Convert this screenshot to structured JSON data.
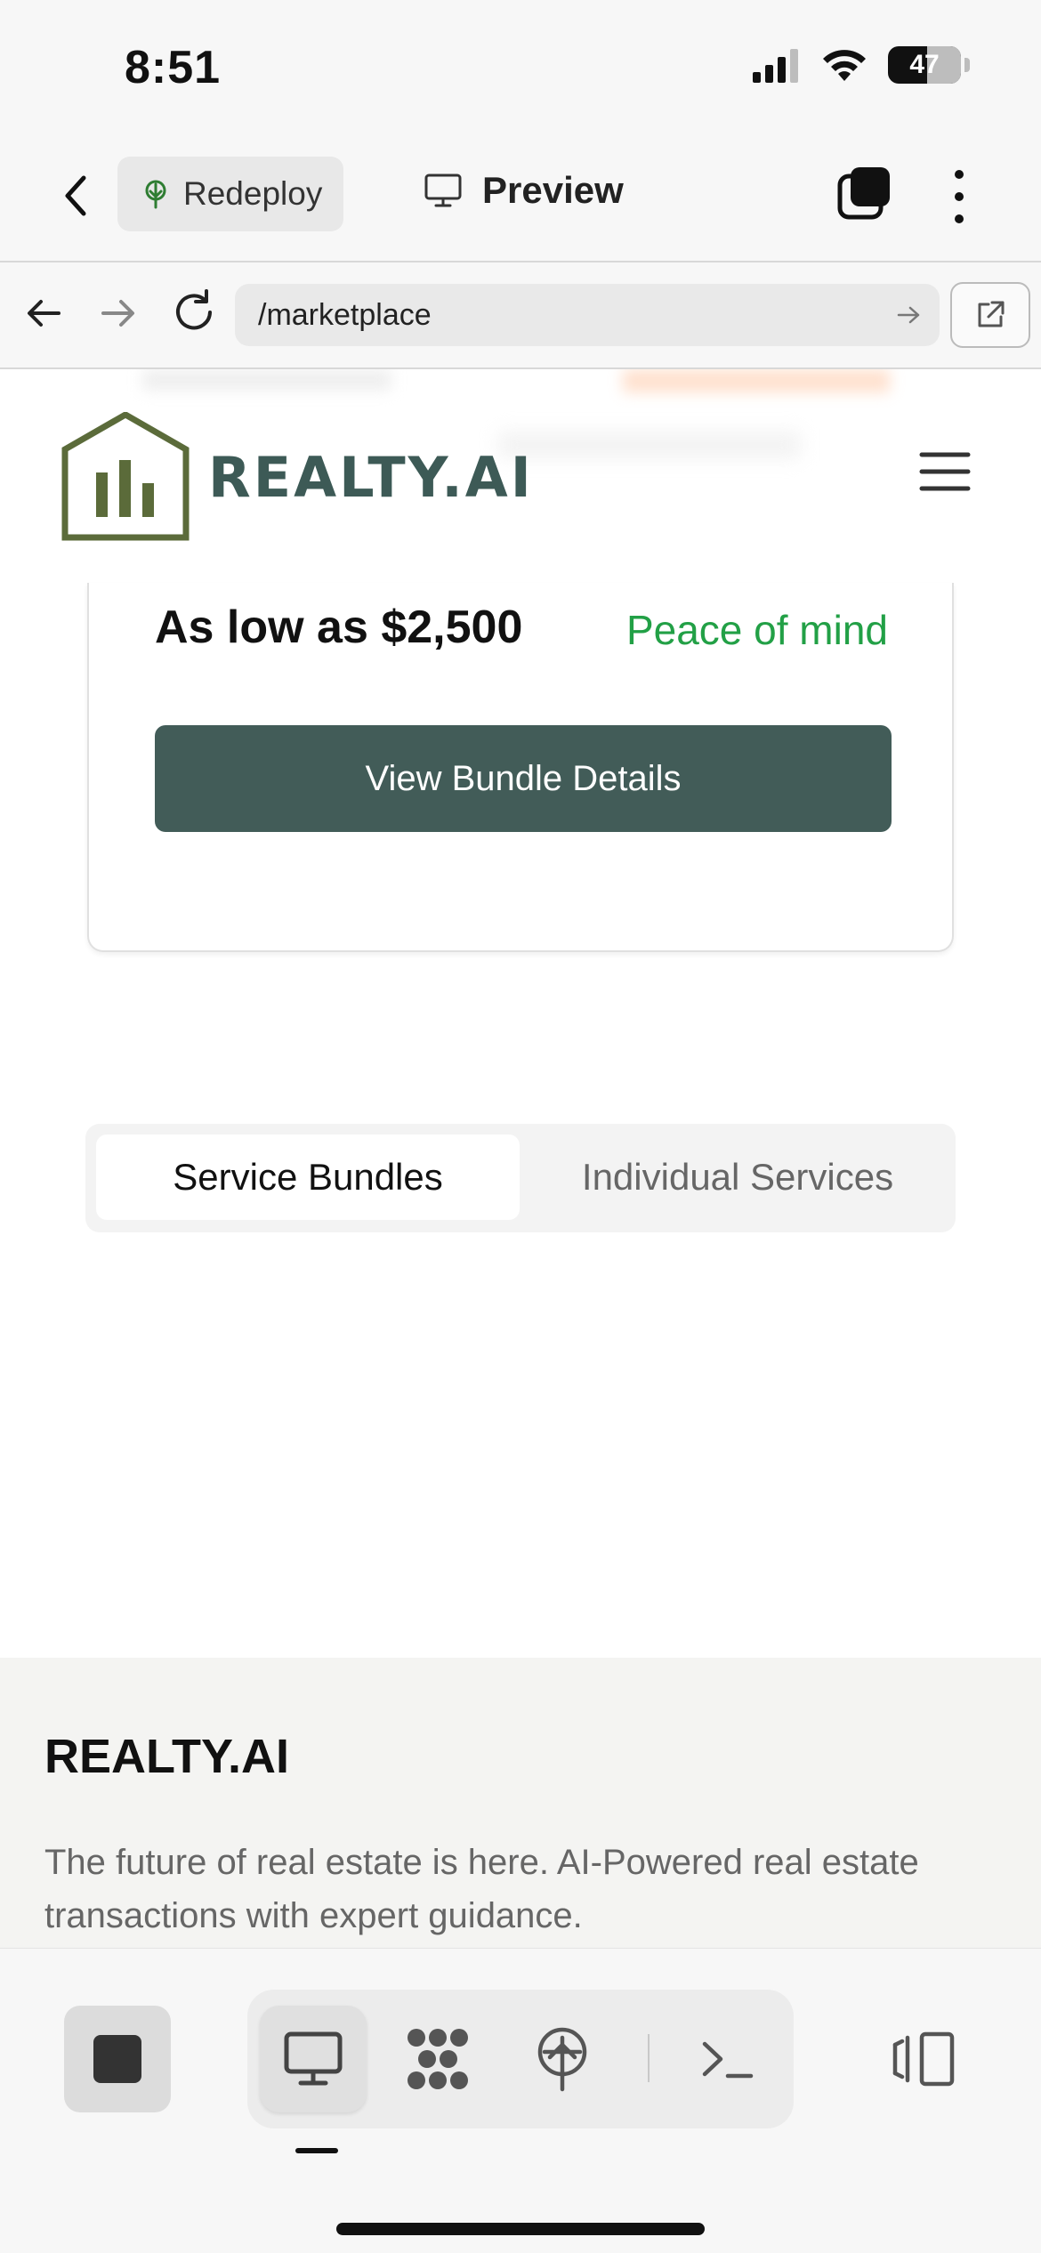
{
  "status_bar": {
    "time": "8:51",
    "battery": "47"
  },
  "app_header": {
    "redeploy_label": "Redeploy",
    "preview_label": "Preview"
  },
  "url_bar": {
    "url": "/marketplace"
  },
  "site": {
    "logo_text": "REALTY.AI"
  },
  "bundle_card": {
    "price": "As low as $2,500",
    "tagline": "Peace of mind",
    "button_label": "View Bundle Details"
  },
  "tabs": {
    "active": "Service Bundles",
    "inactive": "Individual Services"
  },
  "footer": {
    "brand": "REALTY.AI",
    "description": "The future of real estate is here. AI-Powered real estate transactions with expert guidance."
  },
  "colors": {
    "brand_green": "#3d5a56",
    "logo_olive": "#5b6b3a",
    "tagline_green": "#22a046",
    "button_bg": "#425c58"
  },
  "toolbar": {
    "icons": [
      "stop-icon",
      "desktop-icon",
      "network-icon",
      "deploy-icon",
      "terminal-icon",
      "panel-toggle-icon"
    ]
  }
}
